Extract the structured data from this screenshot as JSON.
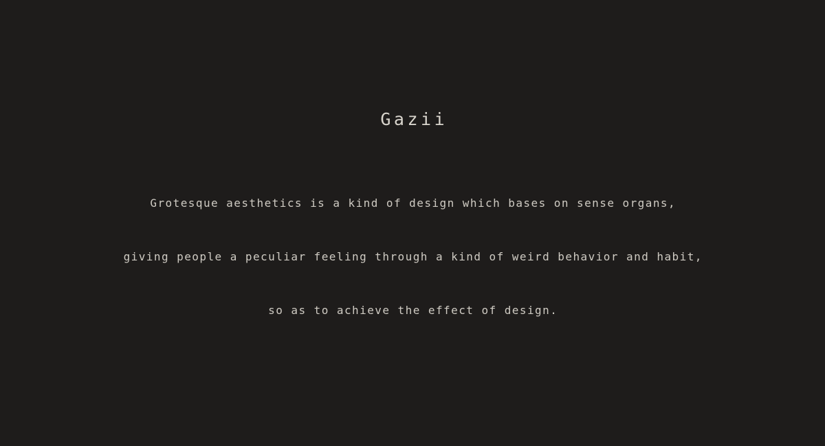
{
  "theme": {
    "background_color": "#1e1c1b",
    "title_color": "#d9d5cd",
    "body_color": "#cfcbc3"
  },
  "header": {
    "title": "Gazii"
  },
  "main": {
    "paragraph_lines": [
      "Grotesque aesthetics is a kind of design which bases on sense organs,",
      "giving people a peculiar feeling through a kind of weird behavior and habit,",
      "so as to achieve the effect of design."
    ]
  }
}
